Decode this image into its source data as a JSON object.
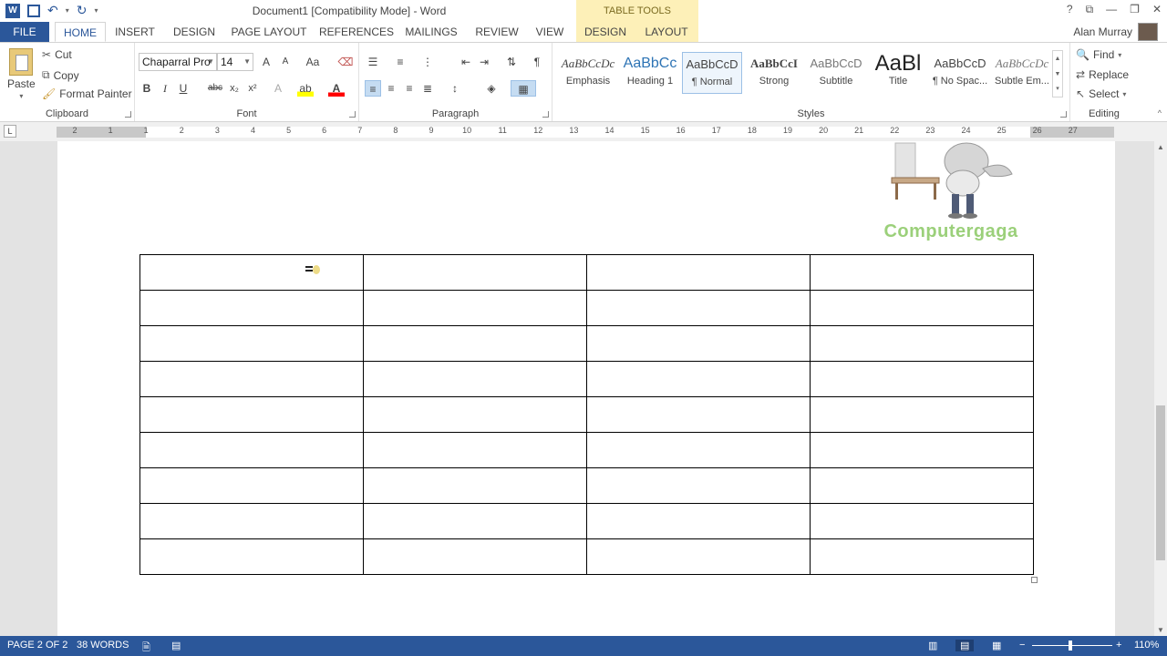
{
  "titlebar": {
    "title": "Document1 [Compatibility Mode] - Word",
    "table_tools": "TABLE TOOLS",
    "help": "?",
    "restore": "⧉",
    "minimize": "—",
    "maximize": "❐",
    "close": "✕"
  },
  "tabs": {
    "file": "FILE",
    "home": "HOME",
    "insert": "INSERT",
    "design": "DESIGN",
    "page_layout": "PAGE LAYOUT",
    "references": "REFERENCES",
    "mailings": "MAILINGS",
    "review": "REVIEW",
    "view": "VIEW",
    "tt_design": "DESIGN",
    "tt_layout": "LAYOUT",
    "user": "Alan Murray"
  },
  "clipboard": {
    "label": "Clipboard",
    "paste": "Paste",
    "cut": "Cut",
    "copy": "Copy",
    "format_painter": "Format Painter"
  },
  "font": {
    "label": "Font",
    "family": "Chaparral Pro",
    "size": "14",
    "bold": "B",
    "italic": "I",
    "underline": "U",
    "strike": "abc",
    "subscript": "x₂",
    "superscript": "x²",
    "grow": "A",
    "shrink": "A",
    "change_case": "Aa",
    "font_color": "A",
    "text_effects": "A"
  },
  "paragraph": {
    "label": "Paragraph",
    "show_marks": "¶"
  },
  "styles": {
    "label": "Styles",
    "items": [
      {
        "sample": "AaBbCcDc",
        "name": "Emphasis"
      },
      {
        "sample": "AaBbCc",
        "name": "Heading 1"
      },
      {
        "sample": "AaBbCcD",
        "name": "¶ Normal"
      },
      {
        "sample": "AaBbCcI",
        "name": "Strong"
      },
      {
        "sample": "AaBbCcD",
        "name": "Subtitle"
      },
      {
        "sample": "AaBl",
        "name": "Title"
      },
      {
        "sample": "AaBbCcD",
        "name": "¶ No Spac..."
      },
      {
        "sample": "AaBbCcDc",
        "name": "Subtle Em..."
      }
    ]
  },
  "editing": {
    "label": "Editing",
    "find": "Find",
    "replace": "Replace",
    "select": "Select"
  },
  "ruler": {
    "numbers": [
      "2",
      "1",
      "1",
      "2",
      "3",
      "4",
      "5",
      "6",
      "7",
      "8",
      "9",
      "10",
      "11",
      "12",
      "13",
      "14",
      "15",
      "16",
      "17",
      "18",
      "19",
      "20",
      "21",
      "22",
      "23",
      "24",
      "25",
      "26",
      "27"
    ],
    "tab_marker": "L"
  },
  "document": {
    "logo_text": "Computergaga",
    "table_rows": 9,
    "table_cols": 4
  },
  "statusbar": {
    "page": "PAGE 2 OF 2",
    "words": "38 WORDS",
    "zoom": "110%"
  },
  "colors": {
    "accent": "#2b579a",
    "table_tools": "#fdf0b8",
    "logo_green": "#9bd07a"
  }
}
